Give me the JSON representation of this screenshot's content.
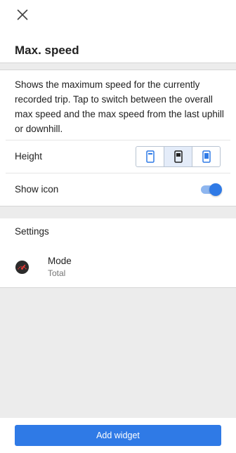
{
  "header": {
    "close_icon": "close-icon",
    "title": "Max. speed"
  },
  "description": "Shows the maximum speed for the currently recorded trip. Tap to switch between the overall max speed and the max speed from the last uphill or downhill.",
  "height_row": {
    "label": "Height",
    "options": [
      {
        "icon": "widget-size-small-icon",
        "selected": false
      },
      {
        "icon": "widget-size-medium-icon",
        "selected": true
      },
      {
        "icon": "widget-size-large-icon",
        "selected": false
      }
    ]
  },
  "show_icon_row": {
    "label": "Show icon",
    "enabled": true
  },
  "settings": {
    "header": "Settings",
    "items": [
      {
        "icon": "speedometer-icon",
        "title": "Mode",
        "value": "Total"
      }
    ]
  },
  "footer": {
    "add_button_label": "Add widget"
  },
  "colors": {
    "accent": "#2f7ae6",
    "toggle_track": "#8eb6ef",
    "divider_band": "#ececec",
    "selected_segment": "#e4ecf9"
  }
}
